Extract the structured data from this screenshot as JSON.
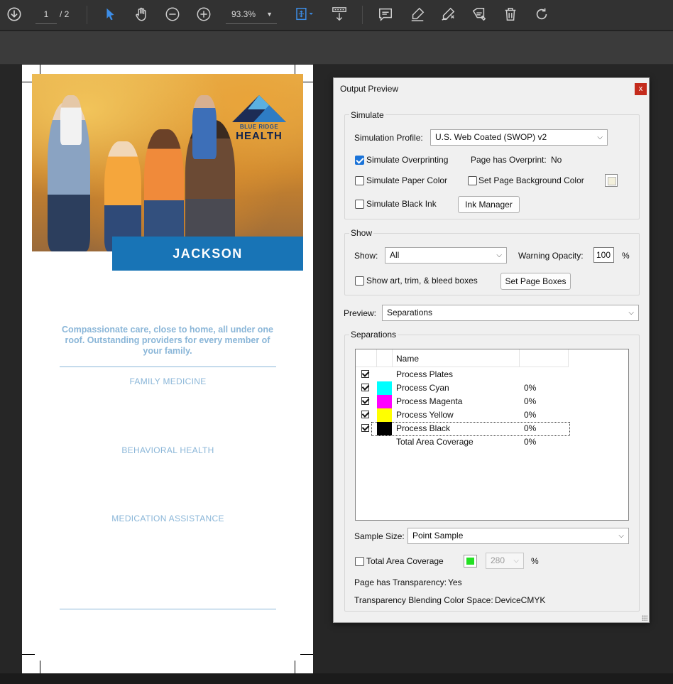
{
  "toolbar": {
    "page_current": "1",
    "page_total": "/ 2",
    "zoom": "93.3%"
  },
  "document": {
    "logo_line1": "BLUE RIDGE",
    "logo_line2": "HEALTH",
    "banner": "JACKSON",
    "tagline": "Compassionate care, close to home, all under one roof. Outstanding providers for every member of your family.",
    "services": [
      "FAMILY MEDICINE",
      "BEHAVIORAL HEALTH",
      "MEDICATION ASSISTANCE"
    ]
  },
  "dialog": {
    "title": "Output Preview",
    "close": "x",
    "simulate": {
      "group_label": "Simulate",
      "profile_label": "Simulation Profile:",
      "profile_value": "U.S. Web Coated (SWOP) v2",
      "overprinting_label": "Simulate Overprinting",
      "overprinting_checked": true,
      "page_overprint_label": "Page has Overprint:",
      "page_overprint_value": "No",
      "paper_color_label": "Simulate Paper Color",
      "page_bg_label": "Set Page Background Color",
      "black_ink_label": "Simulate Black Ink",
      "ink_manager": "Ink Manager"
    },
    "show": {
      "group_label": "Show",
      "show_label": "Show:",
      "show_value": "All",
      "opacity_label": "Warning Opacity:",
      "opacity_value": "100",
      "opacity_unit": "%",
      "boxes_label": "Show art, trim, & bleed boxes",
      "set_boxes": "Set Page Boxes"
    },
    "preview": {
      "label": "Preview:",
      "value": "Separations"
    },
    "separations": {
      "group_label": "Separations",
      "col_name": "Name",
      "rows": [
        {
          "name": "Process Plates",
          "pct": "",
          "color": ""
        },
        {
          "name": "Process Cyan",
          "pct": "0%",
          "color": "#00ffff"
        },
        {
          "name": "Process Magenta",
          "pct": "0%",
          "color": "#ff00ff"
        },
        {
          "name": "Process Yellow",
          "pct": "0%",
          "color": "#ffff00"
        },
        {
          "name": "Process Black",
          "pct": "0%",
          "color": "#000000"
        },
        {
          "name": "Total Area Coverage",
          "pct": "0%",
          "color": ""
        }
      ],
      "sample_label": "Sample Size:",
      "sample_value": "Point Sample",
      "tac_label": "Total Area Coverage",
      "tac_value": "280",
      "tac_unit": "%",
      "transparency_label": "Page has Transparency:",
      "transparency_value": "Yes",
      "blend_label": "Transparency Blending Color Space:",
      "blend_value": "DeviceCMYK"
    }
  },
  "colors": {
    "accent": "#1a73d8",
    "banner": "#1874b6",
    "brand_light_blue": "#8ab6d8"
  }
}
